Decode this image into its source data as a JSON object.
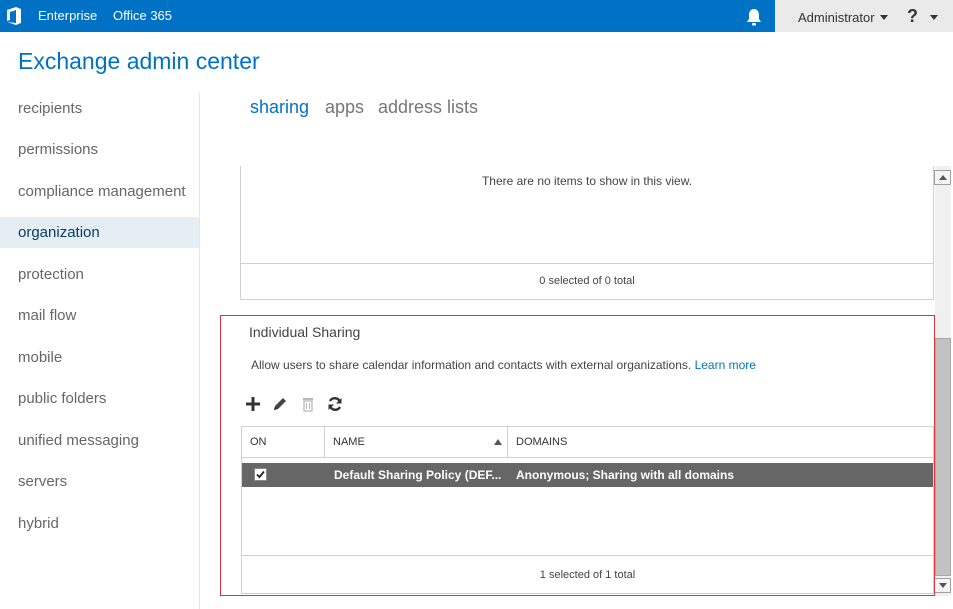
{
  "topbar": {
    "enterprise": "Enterprise",
    "office365": "Office 365",
    "user": "Administrator",
    "help": "?",
    "logo_icon": "office-logo-icon",
    "bell_icon": "bell-icon"
  },
  "page_title": "Exchange admin center",
  "sidebar": {
    "items": [
      {
        "label": "recipients"
      },
      {
        "label": "permissions"
      },
      {
        "label": "compliance management"
      },
      {
        "label": "organization"
      },
      {
        "label": "protection"
      },
      {
        "label": "mail flow"
      },
      {
        "label": "mobile"
      },
      {
        "label": "public folders"
      },
      {
        "label": "unified messaging"
      },
      {
        "label": "servers"
      },
      {
        "label": "hybrid"
      }
    ],
    "active": "organization"
  },
  "tabs": [
    {
      "label": "sharing"
    },
    {
      "label": "apps"
    },
    {
      "label": "address lists"
    }
  ],
  "upper_panel": {
    "empty_message": "There are no items to show in this view.",
    "count": "0 selected of 0 total"
  },
  "individual_sharing": {
    "title": "Individual Sharing",
    "description": "Allow users to share calendar information and contacts with external organizations.",
    "learn_more": "Learn more",
    "toolbar": {
      "add_icon": "plus-icon",
      "edit_icon": "pencil-icon",
      "delete_icon": "trash-icon",
      "refresh_icon": "refresh-icon"
    },
    "columns": [
      "ON",
      "NAME",
      "DOMAINS"
    ],
    "rows": [
      {
        "on": true,
        "name": "Default Sharing Policy (DEF...",
        "domains": "Anonymous; Sharing with all domains"
      }
    ],
    "count": "1 selected of 1 total"
  },
  "colors": {
    "accent": "#0072c6",
    "selected_row": "#666666",
    "highlight_border": "#d9383a"
  }
}
